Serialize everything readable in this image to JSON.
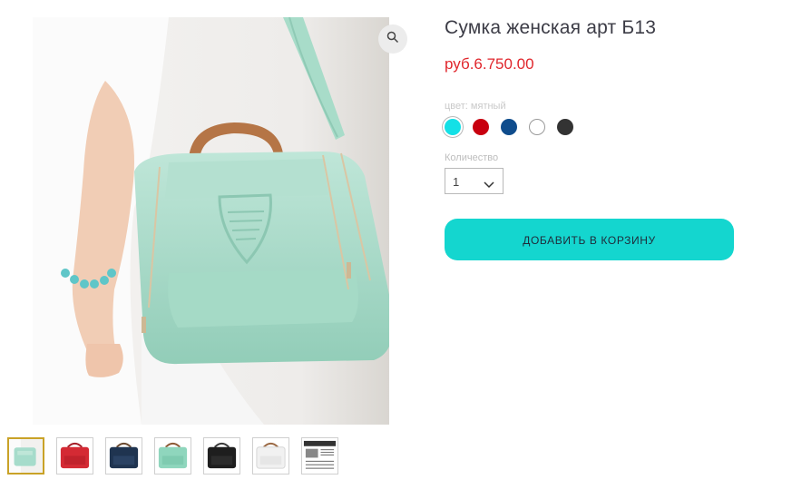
{
  "product": {
    "title": "Сумка женская арт Б13",
    "price": "руб.6.750.00"
  },
  "options": {
    "color_label": "цвет: мятный",
    "colors": [
      {
        "name": "мятный",
        "hex": "#14e0e6",
        "selected": true
      },
      {
        "name": "красный",
        "hex": "#c8000f",
        "selected": false
      },
      {
        "name": "синий",
        "hex": "#0f4c8c",
        "selected": false
      },
      {
        "name": "белый",
        "hex": "#ffffff",
        "selected": false
      },
      {
        "name": "черный",
        "hex": "#333333",
        "selected": false
      }
    ],
    "quantity_label": "Количество",
    "quantity_value": "1"
  },
  "cart": {
    "add_button_label": "ДОБАВИТЬ В КОРЗИНУ"
  },
  "gallery": {
    "zoom_icon": "search-icon",
    "thumbnails": [
      {
        "variant": "model-mint",
        "color": "#a6dccb",
        "active": true
      },
      {
        "variant": "red",
        "color": "#d42a34",
        "active": false
      },
      {
        "variant": "navy",
        "color": "#1f3450",
        "active": false
      },
      {
        "variant": "mint",
        "color": "#8fd6bd",
        "active": false
      },
      {
        "variant": "black",
        "color": "#1e1e1e",
        "active": false
      },
      {
        "variant": "white",
        "color": "#f1f1f1",
        "active": false
      },
      {
        "variant": "size-chart",
        "color": "#ffffff",
        "active": false
      }
    ]
  },
  "colors": {
    "accent": "#14d6cf",
    "price": "#e0262c",
    "title": "#3c3c46"
  }
}
